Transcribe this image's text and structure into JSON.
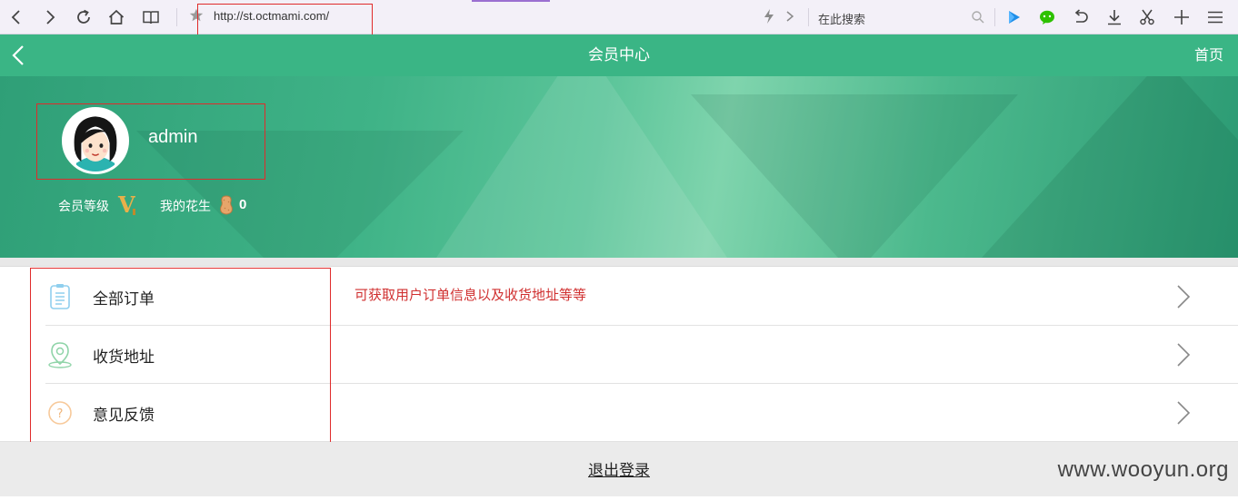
{
  "browser": {
    "url": "http://st.octmami.com/",
    "search_placeholder": "在此搜索"
  },
  "header": {
    "title": "会员中心",
    "home_label": "首页"
  },
  "profile": {
    "username": "admin",
    "level_label": "会员等级",
    "level_badge": "V",
    "peanut_label": "我的花生",
    "peanut_count": "0"
  },
  "menu": {
    "items": [
      {
        "label": "全部订单",
        "icon": "clipboard-icon"
      },
      {
        "label": "收货地址",
        "icon": "location-pin-icon"
      },
      {
        "label": "意见反馈",
        "icon": "question-circle-icon"
      }
    ],
    "annotation": "可获取用户订单信息以及收货地址等等"
  },
  "footer": {
    "logout_label": "退出登录",
    "watermark": "www.wooyun.org"
  },
  "colors": {
    "brand_green": "#3ab585",
    "annotation_red": "#d03030",
    "highlight_box": "#e02b2b"
  }
}
